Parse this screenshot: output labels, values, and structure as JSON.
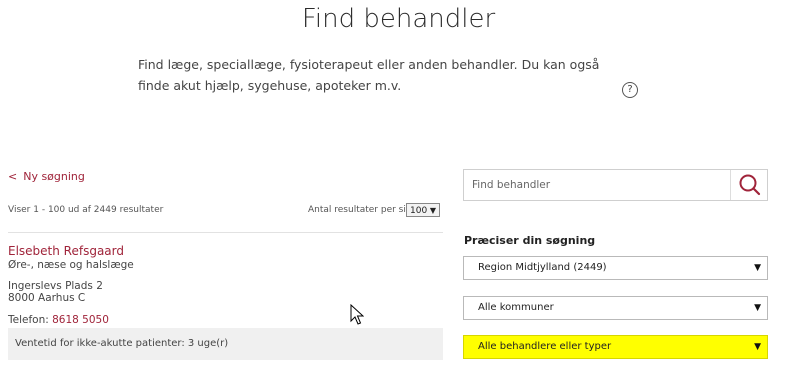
{
  "header": {
    "title": "Find behandler",
    "intro": "Find læge, speciallæge, fysioterapeut eller anden behandler. Du kan også finde akut hjælp, sygehuse, apoteker m.v.",
    "help_glyph": "?"
  },
  "results": {
    "new_search": "Ny søgning",
    "count": "Viser 1 - 100 ud af 2449 resultater",
    "per_page_label": "Antal resultater per side:",
    "per_page_value": "100",
    "items": [
      {
        "name": "Elsebeth Refsgaard",
        "specialty": "Øre-, næse og halslæge",
        "street": "Ingerslevs Plads 2",
        "city": "8000 Aarhus C",
        "phone_label": "Telefon:",
        "phone": "8618 5050",
        "wait": "Ventetid for ikke-akutte patienter: 3 uge(r)"
      }
    ]
  },
  "sidebar": {
    "search_placeholder": "Find behandler",
    "refine_title": "Præciser din søgning",
    "region": "Region Midtjylland (2449)",
    "municipality": "Alle kommuner",
    "type": "Alle behandlere eller typer",
    "highlight_color": "#ffff00"
  },
  "colors": {
    "accent": "#a0243a"
  }
}
